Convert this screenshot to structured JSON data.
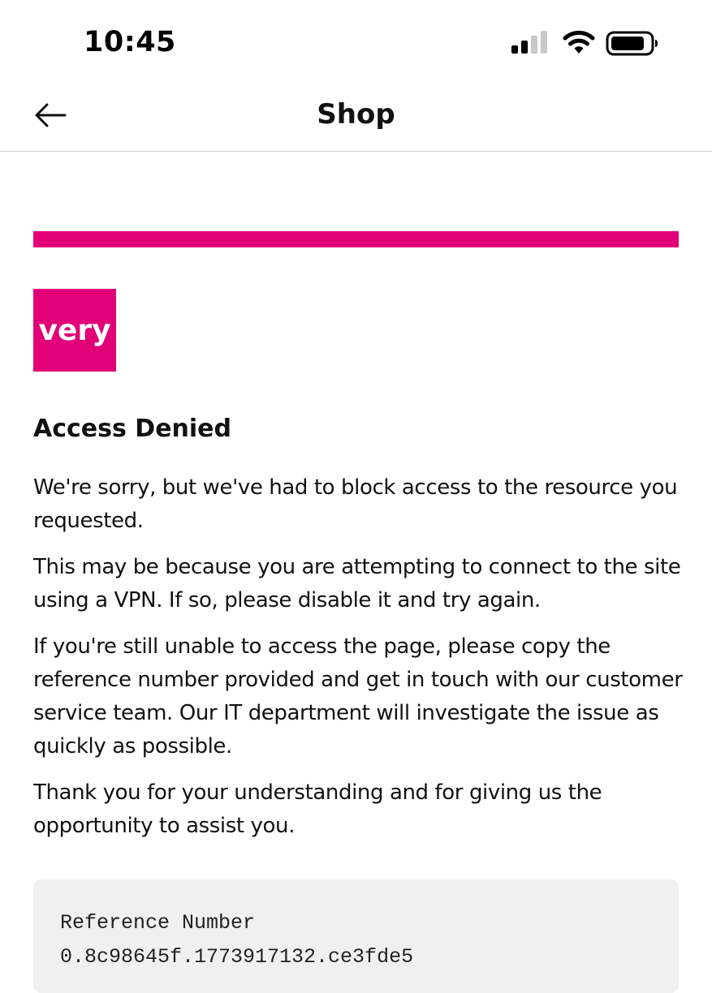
{
  "status_bar": {
    "time": "10:45",
    "icons": [
      "signal-icon",
      "wifi-icon",
      "battery-icon"
    ]
  },
  "nav": {
    "back_icon": "arrow-left-icon",
    "title": "Shop"
  },
  "brand": {
    "accent_color": "#e10078",
    "logo_text": "very",
    "logo_icon": "very-logo"
  },
  "content": {
    "heading": "Access Denied",
    "paragraphs": [
      "We're sorry, but we've had to block access to the resource you requested.",
      "This may be because you are attempting to connect to the site using a VPN. If so, please disable it and try again.",
      "If you're still unable to access the page, please copy the reference number provided and get in touch with our customer service team. Our IT department will investigate the issue as quickly as possible.",
      "Thank you for your understanding and for giving us the opportunity to assist you."
    ]
  },
  "reference": {
    "label": "Reference Number",
    "value": "0.8c98645f.1773917132.ce3fde5"
  }
}
